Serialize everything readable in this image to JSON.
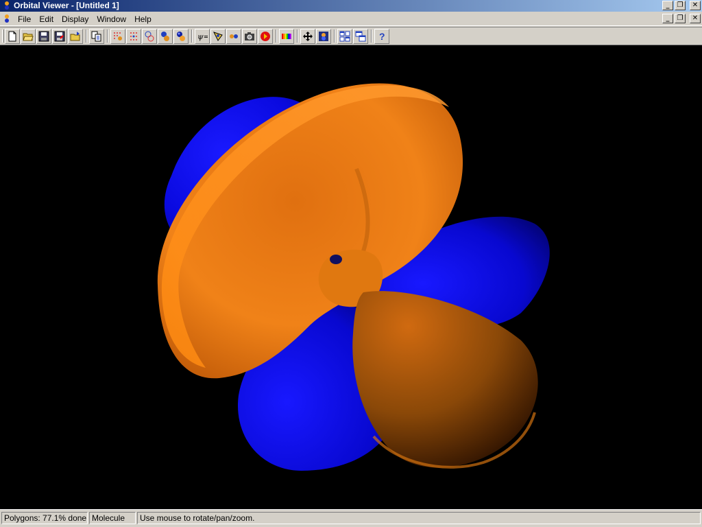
{
  "window": {
    "title": "Orbital Viewer - [Untitled 1]",
    "controls": {
      "minimize": "_",
      "restore": "❐",
      "close": "✕"
    }
  },
  "menu": {
    "items": [
      {
        "label": "File"
      },
      {
        "label": "Edit"
      },
      {
        "label": "Display"
      },
      {
        "label": "Window"
      },
      {
        "label": "Help"
      }
    ]
  },
  "toolbar": {
    "buttons": [
      "new-icon",
      "open-icon",
      "save-icon",
      "save-as-icon",
      "open-folder-icon",
      "copy-icon",
      "points-icon",
      "polygons-icon",
      "wireframe-icon",
      "solid-icon",
      "smooth-icon",
      "psi-icon",
      "cutaway-icon",
      "stereo-icon",
      "camera-icon",
      "record-icon",
      "palette-icon",
      "move-icon",
      "render-icon",
      "tile-icon",
      "cascade-icon",
      "help-icon"
    ],
    "labels": {
      "psi": "ψ=",
      "help": "?"
    }
  },
  "viewport": {
    "background": "#000000",
    "positive_lobe_color": "#ff8000",
    "negative_lobe_color": "#0a0af0"
  },
  "status": {
    "progress_text": "Polygons: 77.1% done",
    "progress_value": 77.1,
    "mode": "Molecule",
    "hint": "Use mouse to rotate/pan/zoom."
  }
}
